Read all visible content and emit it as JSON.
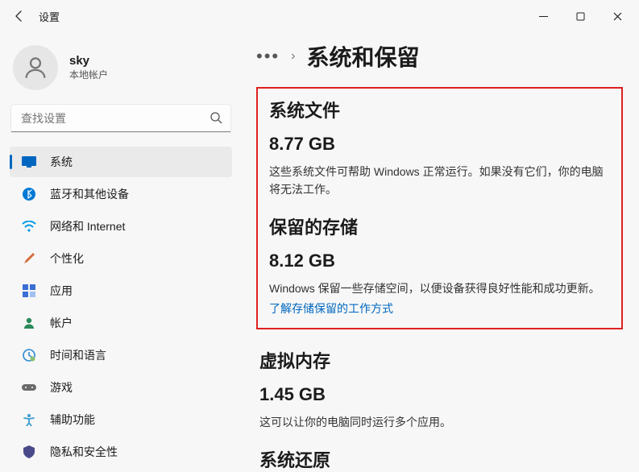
{
  "titlebar": {
    "app_name": "设置"
  },
  "profile": {
    "name": "sky",
    "subtitle": "本地帐户"
  },
  "search": {
    "placeholder": "查找设置"
  },
  "nav": {
    "items": [
      {
        "label": "系统"
      },
      {
        "label": "蓝牙和其他设备"
      },
      {
        "label": "网络和 Internet"
      },
      {
        "label": "个性化"
      },
      {
        "label": "应用"
      },
      {
        "label": "帐户"
      },
      {
        "label": "时间和语言"
      },
      {
        "label": "游戏"
      },
      {
        "label": "辅助功能"
      },
      {
        "label": "隐私和安全性"
      }
    ]
  },
  "breadcrumb": {
    "page_title": "系统和保留"
  },
  "sections": {
    "system_files": {
      "title": "系统文件",
      "value": "8.77 GB",
      "desc": "这些系统文件可帮助 Windows 正常运行。如果没有它们，你的电脑将无法工作。"
    },
    "reserved_storage": {
      "title": "保留的存储",
      "value": "8.12 GB",
      "desc": "Windows 保留一些存储空间，以便设备获得良好性能和成功更新。",
      "link": "了解存储保留的工作方式"
    },
    "virtual_memory": {
      "title": "虚拟内存",
      "value": "1.45 GB",
      "desc": "这可以让你的电脑同时运行多个应用。"
    },
    "system_restore": {
      "title": "系统还原"
    }
  },
  "icons": {
    "system_color": "#0067c0",
    "bluetooth_color": "#0078d4",
    "network_color": "#0099e5",
    "personalize_color": "#d46a3a",
    "apps_color": "#3a6ed4",
    "account_color": "#2a8a5a",
    "time_color": "#2a8ad4",
    "gaming_color": "#6a6a6a",
    "accessibility_color": "#3a9ed4",
    "privacy_color": "#4a4a8a"
  }
}
